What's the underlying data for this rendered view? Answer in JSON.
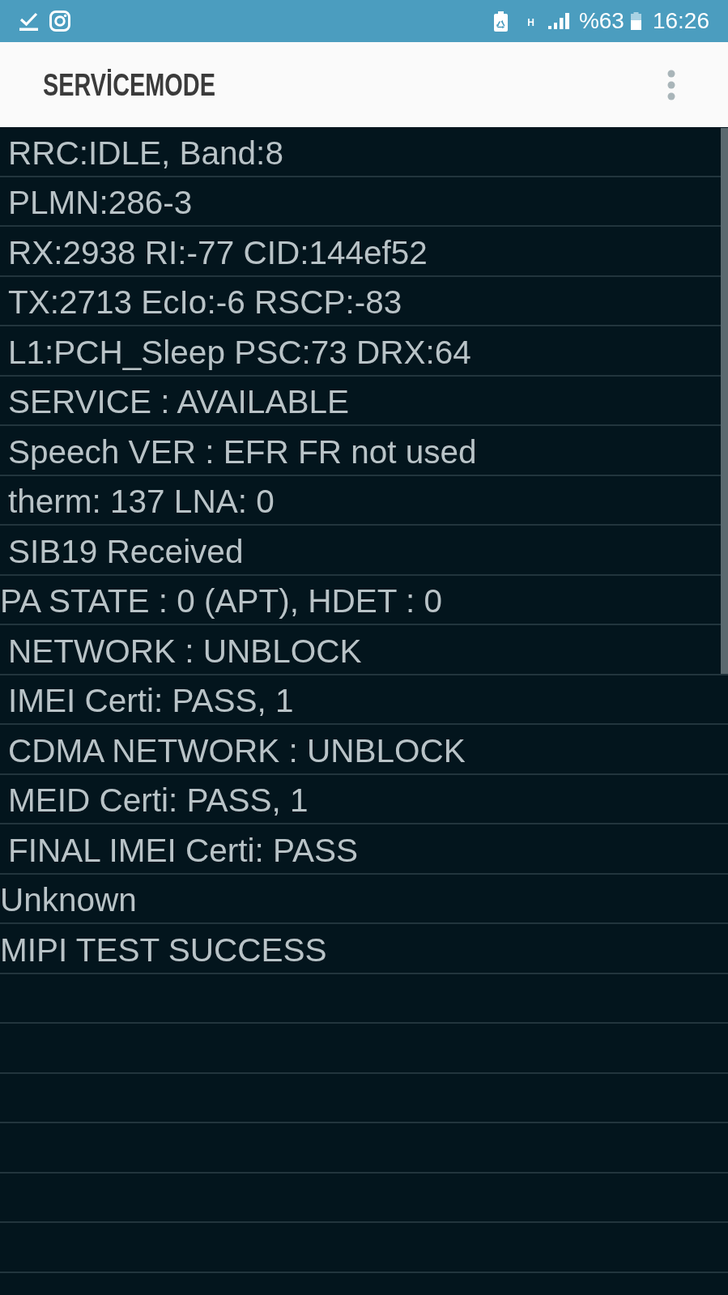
{
  "status_bar": {
    "network_type": "H",
    "battery_percent": "%63",
    "time": "16:26"
  },
  "app_bar": {
    "title": "SERVİCEMODE"
  },
  "rows": [
    {
      "text": "RRC:IDLE, Band:8",
      "indented": true
    },
    {
      "text": "PLMN:286-3",
      "indented": true
    },
    {
      "text": "RX:2938 RI:-77 CID:144ef52",
      "indented": true
    },
    {
      "text": "TX:2713 EcIo:-6 RSCP:-83",
      "indented": true
    },
    {
      "text": "L1:PCH_Sleep PSC:73 DRX:64",
      "indented": true
    },
    {
      "text": "SERVICE : AVAILABLE",
      "indented": true
    },
    {
      "text": "Speech VER : EFR FR not used",
      "indented": true
    },
    {
      "text": "therm: 137 LNA: 0",
      "indented": true
    },
    {
      "text": "SIB19 Received",
      "indented": true
    },
    {
      "text": "PA STATE : 0 (APT), HDET : 0",
      "indented": false
    },
    {
      "text": "NETWORK : UNBLOCK",
      "indented": true
    },
    {
      "text": "IMEI Certi: PASS, 1",
      "indented": true
    },
    {
      "text": "CDMA NETWORK : UNBLOCK",
      "indented": true
    },
    {
      "text": "MEID Certi: PASS, 1",
      "indented": true
    },
    {
      "text": "FINAL IMEI Certi: PASS",
      "indented": true
    },
    {
      "text": "Unknown",
      "indented": false
    },
    {
      "text": "MIPI TEST SUCCESS",
      "indented": false
    }
  ]
}
